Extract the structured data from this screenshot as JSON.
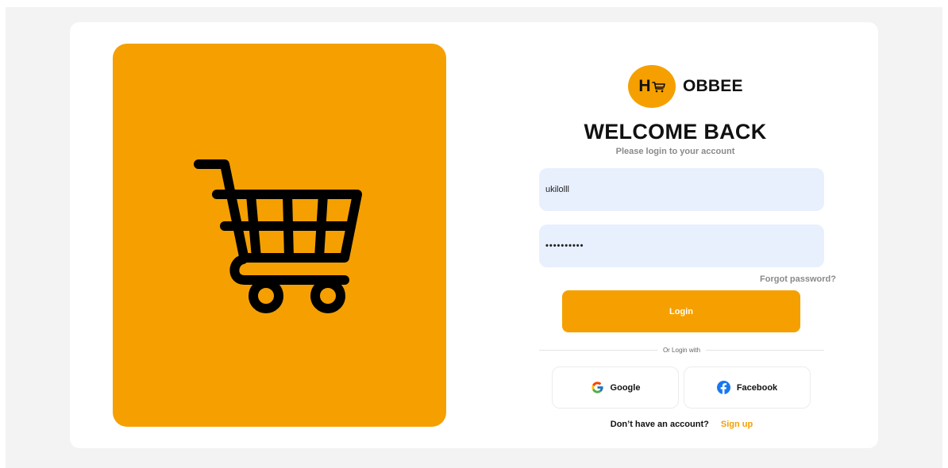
{
  "brand": {
    "logo_letter": "H",
    "name": "OBBEE",
    "accent_color": "#f5a000"
  },
  "hero": {
    "icon": "shopping-cart-icon"
  },
  "login": {
    "title": "WELCOME BACK",
    "subtitle": "Please login to your account",
    "username_value": "ukilolll",
    "password_value": "••••••••••",
    "forgot_label": "Forgot password?",
    "login_label": "Login",
    "divider_label": "Or Login with"
  },
  "social": {
    "google_label": "Google",
    "google_icon": "google-icon",
    "facebook_label": "Facebook",
    "facebook_icon": "facebook-icon"
  },
  "signup": {
    "prompt": "Don’t have an account?",
    "link_label": "Sign up"
  }
}
